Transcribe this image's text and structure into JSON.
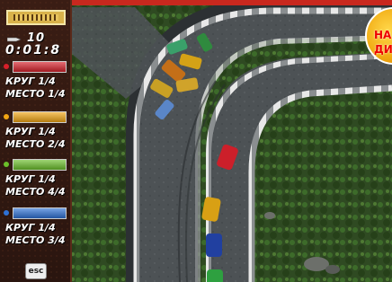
{
  "hud": {
    "ammo": "10",
    "timer": "0:01:8",
    "players": [
      {
        "color": "#d8202a",
        "lap_line": "КРУГ 1/4",
        "place_line": "МЕСТО 1/4"
      },
      {
        "color": "#f2a614",
        "lap_line": "КРУГ 1/4",
        "place_line": "МЕСТО 2/4"
      },
      {
        "color": "#6bbf2a",
        "lap_line": "КРУГ 1/4",
        "place_line": "МЕСТО 4/4"
      },
      {
        "color": "#2e72d6",
        "lap_line": "КРУГ 1/4",
        "place_line": "МЕСТО 3/4"
      }
    ],
    "esc_label": "esc"
  },
  "badge": {
    "line1": "НА",
    "line2": "ДИ"
  },
  "colors": {
    "hud_bg": "#2a150f",
    "road": "#4a4f52",
    "grass": "#2f4a22",
    "curb_white": "#e8e8e8",
    "frame_red": "#c8281e"
  }
}
